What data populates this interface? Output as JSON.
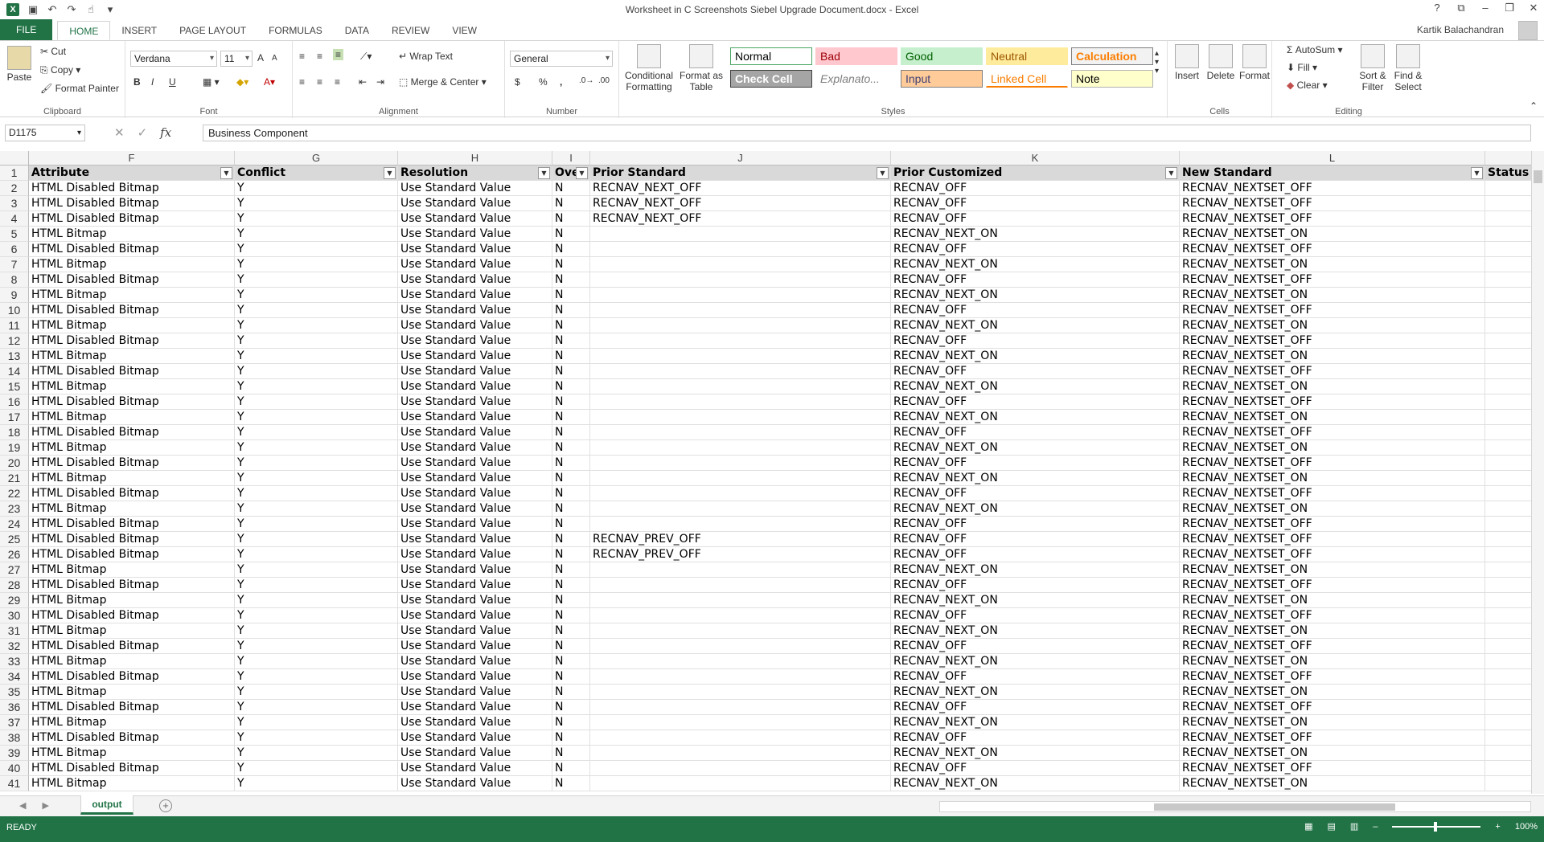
{
  "window": {
    "title": "Worksheet in C  Screenshots Siebel Upgrade Document.docx - Excel",
    "user": "Kartik Balachandran"
  },
  "ribbon_tabs": [
    "FILE",
    "HOME",
    "INSERT",
    "PAGE LAYOUT",
    "FORMULAS",
    "DATA",
    "REVIEW",
    "VIEW"
  ],
  "ribbon": {
    "clipboard": {
      "label": "Clipboard",
      "paste": "Paste",
      "cut": "Cut",
      "copy": "Copy",
      "format_painter": "Format Painter"
    },
    "font": {
      "label": "Font",
      "name": "Verdana",
      "size": "11",
      "bold": "B",
      "italic": "I",
      "underline": "U"
    },
    "alignment": {
      "label": "Alignment",
      "wrap_text": "Wrap Text",
      "merge_center": "Merge & Center"
    },
    "number": {
      "label": "Number",
      "format": "General",
      "currency": "$",
      "percent": "%",
      "comma": ","
    },
    "styles": {
      "label": "Styles",
      "conditional": "Conditional Formatting",
      "format_table": "Format as Table",
      "cells": [
        {
          "name": "Normal",
          "bg": "#ffffff",
          "fg": "#000000",
          "border": "#4aa564"
        },
        {
          "name": "Bad",
          "bg": "#ffc7ce",
          "fg": "#9c0006",
          "border": "#ffc7ce"
        },
        {
          "name": "Good",
          "bg": "#c6efce",
          "fg": "#006100",
          "border": "#c6efce"
        },
        {
          "name": "Neutral",
          "bg": "#ffeb9c",
          "fg": "#9c5700",
          "border": "#ffeb9c"
        },
        {
          "name": "Calculation",
          "bg": "#f2f2f2",
          "fg": "#fa7d00",
          "border": "#7f7f7f"
        },
        {
          "name": "Check Cell",
          "bg": "#a5a5a5",
          "fg": "#ffffff",
          "border": "#3f3f3f"
        },
        {
          "name": "Explanato...",
          "bg": "#ffffff",
          "fg": "#7f7f7f",
          "border": "#ffffff"
        },
        {
          "name": "Input",
          "bg": "#ffcc99",
          "fg": "#3f3f76",
          "border": "#7f7f7f"
        },
        {
          "name": "Linked Cell",
          "bg": "#ffffff",
          "fg": "#fa7d00",
          "border": "#ffffff"
        },
        {
          "name": "Note",
          "bg": "#ffffcc",
          "fg": "#000000",
          "border": "#b2b2b2"
        }
      ]
    },
    "cells": {
      "label": "Cells",
      "insert": "Insert",
      "delete": "Delete",
      "format": "Format"
    },
    "editing": {
      "label": "Editing",
      "autosum": "AutoSum",
      "fill": "Fill",
      "clear": "Clear",
      "sort": "Sort & Filter",
      "find": "Find & Select"
    }
  },
  "formula_bar": {
    "name_box": "D1175",
    "fx": "fx",
    "value": "Business Component"
  },
  "columns": [
    {
      "letter": "F",
      "header": "Attribute"
    },
    {
      "letter": "G",
      "header": "Conflict"
    },
    {
      "letter": "H",
      "header": "Resolution"
    },
    {
      "letter": "I",
      "header": "Ove"
    },
    {
      "letter": "J",
      "header": "Prior Standard"
    },
    {
      "letter": "K",
      "header": "Prior Customized"
    },
    {
      "letter": "L",
      "header": "New Standard"
    },
    {
      "letter": "",
      "header": "Status"
    }
  ],
  "rows": [
    [
      "HTML Disabled Bitmap",
      "Y",
      "Use Standard Value",
      "N",
      "RECNAV_NEXT_OFF",
      "RECNAV_OFF",
      "RECNAV_NEXTSET_OFF"
    ],
    [
      "HTML Disabled Bitmap",
      "Y",
      "Use Standard Value",
      "N",
      "RECNAV_NEXT_OFF",
      "RECNAV_OFF",
      "RECNAV_NEXTSET_OFF"
    ],
    [
      "HTML Disabled Bitmap",
      "Y",
      "Use Standard Value",
      "N",
      "RECNAV_NEXT_OFF",
      "RECNAV_OFF",
      "RECNAV_NEXTSET_OFF"
    ],
    [
      "HTML Bitmap",
      "Y",
      "Use Standard Value",
      "N",
      "",
      "RECNAV_NEXT_ON",
      "RECNAV_NEXTSET_ON"
    ],
    [
      "HTML Disabled Bitmap",
      "Y",
      "Use Standard Value",
      "N",
      "",
      "RECNAV_OFF",
      "RECNAV_NEXTSET_OFF"
    ],
    [
      "HTML Bitmap",
      "Y",
      "Use Standard Value",
      "N",
      "",
      "RECNAV_NEXT_ON",
      "RECNAV_NEXTSET_ON"
    ],
    [
      "HTML Disabled Bitmap",
      "Y",
      "Use Standard Value",
      "N",
      "",
      "RECNAV_OFF",
      "RECNAV_NEXTSET_OFF"
    ],
    [
      "HTML Bitmap",
      "Y",
      "Use Standard Value",
      "N",
      "",
      "RECNAV_NEXT_ON",
      "RECNAV_NEXTSET_ON"
    ],
    [
      "HTML Disabled Bitmap",
      "Y",
      "Use Standard Value",
      "N",
      "",
      "RECNAV_OFF",
      "RECNAV_NEXTSET_OFF"
    ],
    [
      "HTML Bitmap",
      "Y",
      "Use Standard Value",
      "N",
      "",
      "RECNAV_NEXT_ON",
      "RECNAV_NEXTSET_ON"
    ],
    [
      "HTML Disabled Bitmap",
      "Y",
      "Use Standard Value",
      "N",
      "",
      "RECNAV_OFF",
      "RECNAV_NEXTSET_OFF"
    ],
    [
      "HTML Bitmap",
      "Y",
      "Use Standard Value",
      "N",
      "",
      "RECNAV_NEXT_ON",
      "RECNAV_NEXTSET_ON"
    ],
    [
      "HTML Disabled Bitmap",
      "Y",
      "Use Standard Value",
      "N",
      "",
      "RECNAV_OFF",
      "RECNAV_NEXTSET_OFF"
    ],
    [
      "HTML Bitmap",
      "Y",
      "Use Standard Value",
      "N",
      "",
      "RECNAV_NEXT_ON",
      "RECNAV_NEXTSET_ON"
    ],
    [
      "HTML Disabled Bitmap",
      "Y",
      "Use Standard Value",
      "N",
      "",
      "RECNAV_OFF",
      "RECNAV_NEXTSET_OFF"
    ],
    [
      "HTML Bitmap",
      "Y",
      "Use Standard Value",
      "N",
      "",
      "RECNAV_NEXT_ON",
      "RECNAV_NEXTSET_ON"
    ],
    [
      "HTML Disabled Bitmap",
      "Y",
      "Use Standard Value",
      "N",
      "",
      "RECNAV_OFF",
      "RECNAV_NEXTSET_OFF"
    ],
    [
      "HTML Bitmap",
      "Y",
      "Use Standard Value",
      "N",
      "",
      "RECNAV_NEXT_ON",
      "RECNAV_NEXTSET_ON"
    ],
    [
      "HTML Disabled Bitmap",
      "Y",
      "Use Standard Value",
      "N",
      "",
      "RECNAV_OFF",
      "RECNAV_NEXTSET_OFF"
    ],
    [
      "HTML Bitmap",
      "Y",
      "Use Standard Value",
      "N",
      "",
      "RECNAV_NEXT_ON",
      "RECNAV_NEXTSET_ON"
    ],
    [
      "HTML Disabled Bitmap",
      "Y",
      "Use Standard Value",
      "N",
      "",
      "RECNAV_OFF",
      "RECNAV_NEXTSET_OFF"
    ],
    [
      "HTML Bitmap",
      "Y",
      "Use Standard Value",
      "N",
      "",
      "RECNAV_NEXT_ON",
      "RECNAV_NEXTSET_ON"
    ],
    [
      "HTML Disabled Bitmap",
      "Y",
      "Use Standard Value",
      "N",
      "",
      "RECNAV_OFF",
      "RECNAV_NEXTSET_OFF"
    ],
    [
      "HTML Disabled Bitmap",
      "Y",
      "Use Standard Value",
      "N",
      "RECNAV_PREV_OFF",
      "RECNAV_OFF",
      "RECNAV_NEXTSET_OFF"
    ],
    [
      "HTML Disabled Bitmap",
      "Y",
      "Use Standard Value",
      "N",
      "RECNAV_PREV_OFF",
      "RECNAV_OFF",
      "RECNAV_NEXTSET_OFF"
    ],
    [
      "HTML Bitmap",
      "Y",
      "Use Standard Value",
      "N",
      "",
      "RECNAV_NEXT_ON",
      "RECNAV_NEXTSET_ON"
    ],
    [
      "HTML Disabled Bitmap",
      "Y",
      "Use Standard Value",
      "N",
      "",
      "RECNAV_OFF",
      "RECNAV_NEXTSET_OFF"
    ],
    [
      "HTML Bitmap",
      "Y",
      "Use Standard Value",
      "N",
      "",
      "RECNAV_NEXT_ON",
      "RECNAV_NEXTSET_ON"
    ],
    [
      "HTML Disabled Bitmap",
      "Y",
      "Use Standard Value",
      "N",
      "",
      "RECNAV_OFF",
      "RECNAV_NEXTSET_OFF"
    ],
    [
      "HTML Bitmap",
      "Y",
      "Use Standard Value",
      "N",
      "",
      "RECNAV_NEXT_ON",
      "RECNAV_NEXTSET_ON"
    ],
    [
      "HTML Disabled Bitmap",
      "Y",
      "Use Standard Value",
      "N",
      "",
      "RECNAV_OFF",
      "RECNAV_NEXTSET_OFF"
    ],
    [
      "HTML Bitmap",
      "Y",
      "Use Standard Value",
      "N",
      "",
      "RECNAV_NEXT_ON",
      "RECNAV_NEXTSET_ON"
    ],
    [
      "HTML Disabled Bitmap",
      "Y",
      "Use Standard Value",
      "N",
      "",
      "RECNAV_OFF",
      "RECNAV_NEXTSET_OFF"
    ],
    [
      "HTML Bitmap",
      "Y",
      "Use Standard Value",
      "N",
      "",
      "RECNAV_NEXT_ON",
      "RECNAV_NEXTSET_ON"
    ],
    [
      "HTML Disabled Bitmap",
      "Y",
      "Use Standard Value",
      "N",
      "",
      "RECNAV_OFF",
      "RECNAV_NEXTSET_OFF"
    ],
    [
      "HTML Bitmap",
      "Y",
      "Use Standard Value",
      "N",
      "",
      "RECNAV_NEXT_ON",
      "RECNAV_NEXTSET_ON"
    ],
    [
      "HTML Disabled Bitmap",
      "Y",
      "Use Standard Value",
      "N",
      "",
      "RECNAV_OFF",
      "RECNAV_NEXTSET_OFF"
    ],
    [
      "HTML Bitmap",
      "Y",
      "Use Standard Value",
      "N",
      "",
      "RECNAV_NEXT_ON",
      "RECNAV_NEXTSET_ON"
    ],
    [
      "HTML Disabled Bitmap",
      "Y",
      "Use Standard Value",
      "N",
      "",
      "RECNAV_OFF",
      "RECNAV_NEXTSET_OFF"
    ],
    [
      "HTML Bitmap",
      "Y",
      "Use Standard Value",
      "N",
      "",
      "RECNAV_NEXT_ON",
      "RECNAV_NEXTSET_ON"
    ]
  ],
  "sheet_tabs": [
    "output"
  ],
  "status": {
    "ready": "READY",
    "zoom": "100%"
  }
}
